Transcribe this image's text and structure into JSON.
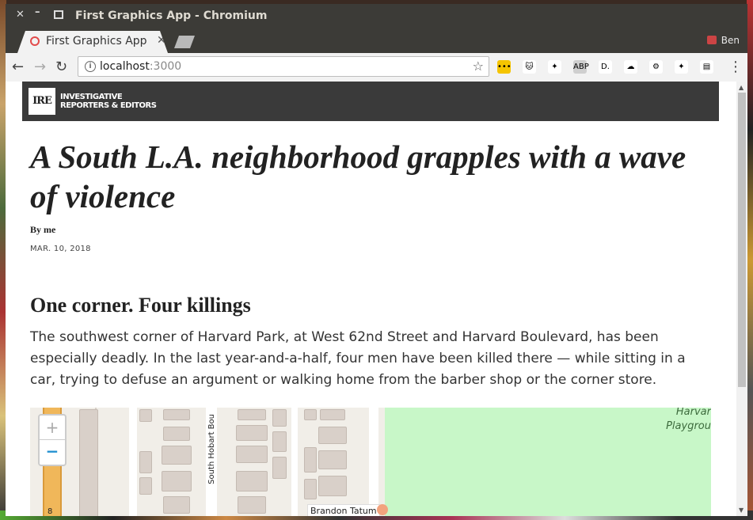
{
  "window": {
    "title": "First Graphics App - Chromium",
    "close_glyph": "✕",
    "min_glyph": "–"
  },
  "tab": {
    "label": "First Graphics App",
    "close_glyph": "✕"
  },
  "profile": {
    "name": "Ben"
  },
  "toolbar": {
    "back_glyph": "←",
    "forward_glyph": "→",
    "reload_glyph": "↻",
    "url_host": "localhost",
    "url_port": ":3000",
    "info_glyph": "i",
    "star_glyph": "☆",
    "extensions": [
      {
        "name": "extension-yellow-icon",
        "glyph": "•••",
        "color": "#f5c400"
      },
      {
        "name": "extension-cat-icon",
        "glyph": "🐱",
        "color": "#ffffff"
      },
      {
        "name": "extension-pin-icon",
        "glyph": "✦",
        "color": "#ffffff"
      },
      {
        "name": "adblock-plus-icon",
        "glyph": "ABP",
        "color": "#cfcfcf"
      },
      {
        "name": "extension-d-icon",
        "glyph": "D.",
        "color": "#ffffff"
      },
      {
        "name": "extension-cloud-icon",
        "glyph": "☁",
        "color": "#ffffff"
      },
      {
        "name": "extension-gear-icon",
        "glyph": "⚙",
        "color": "#ffffff"
      },
      {
        "name": "extension-pin2-icon",
        "glyph": "✦",
        "color": "#ffffff"
      },
      {
        "name": "extension-doc-icon",
        "glyph": "▤",
        "color": "#ffffff"
      }
    ],
    "menu_glyph": "⋮"
  },
  "page": {
    "logo_abbr": "IRE",
    "logo_line1": "INVESTIGATIVE",
    "logo_line2": "REPORTERS & EDITORS",
    "headline": "A South L.A. neighborhood grapples with a wave of violence",
    "byline": "By me",
    "date": "MAR. 10, 2018",
    "subhead": "One corner. Four killings",
    "body": "The southwest corner of Harvard Park, at West 62nd Street and Harvard Boulevard, has been especially deadly. In the last year-and-a-half, four men have been killed there — while sitting in a car, trying to defuse an argument or walking home from the barber shop or the corner store."
  },
  "map": {
    "zoom_in": "+",
    "zoom_out": "−",
    "park_label_line1": "Harvar",
    "park_label_line2": "Playgrou",
    "street_label": "South Hobart Bou",
    "pin_label": "Brandon Tatum",
    "corner_mark": "8"
  },
  "scrollbar": {
    "up_glyph": "▲",
    "down_glyph": "▼"
  },
  "colors": {
    "titlebar": "#3c3b37",
    "ire_bar": "#3a3a3a",
    "park": "#c8f7c8",
    "highway": "#f0b75a",
    "pin": "#f2a37e"
  }
}
